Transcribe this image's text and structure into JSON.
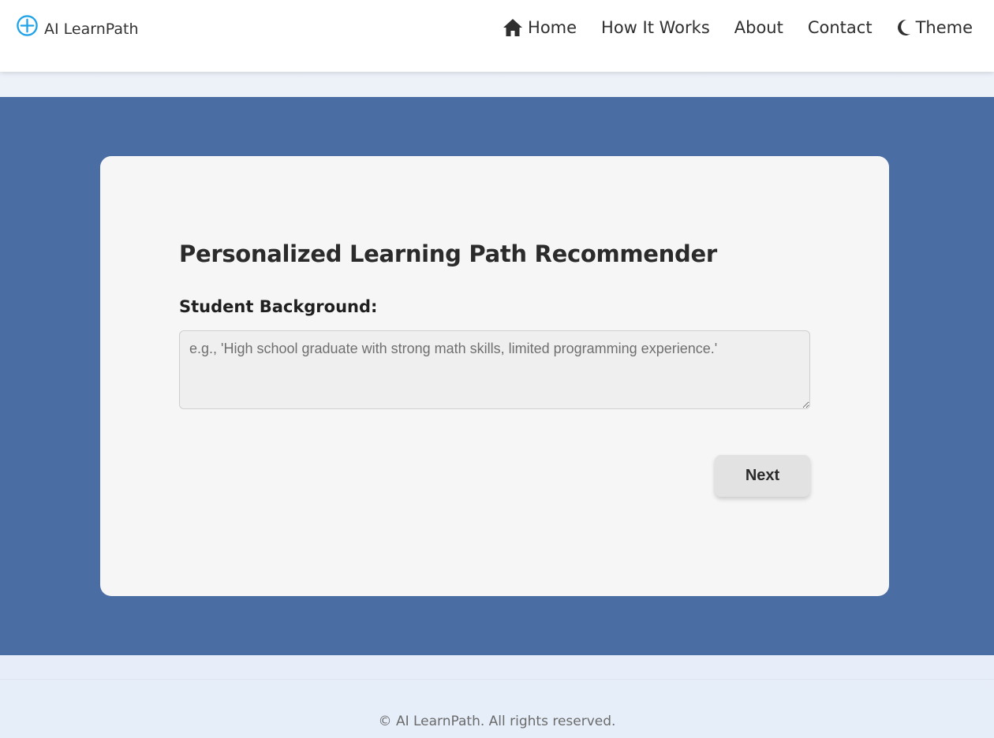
{
  "brand": {
    "name": "AI LearnPath",
    "icon": "compass-plus-icon",
    "icon_color": "#1fa3e8"
  },
  "nav": {
    "items": [
      {
        "label": "Home",
        "icon": "home-icon"
      },
      {
        "label": "How It Works"
      },
      {
        "label": "About"
      },
      {
        "label": "Contact"
      },
      {
        "label": "Theme",
        "icon": "moon-icon"
      }
    ]
  },
  "colors": {
    "hero_bg": "#4a6ea3",
    "card_bg": "#f6f6f6"
  },
  "form": {
    "title": "Personalized Learning Path Recommender",
    "background_label": "Student Background:",
    "background_value": "",
    "background_placeholder": "e.g., 'High school graduate with strong math skills, limited programming experience.'",
    "next_label": "Next"
  },
  "footer": {
    "text": "© AI LearnPath. All rights reserved."
  }
}
